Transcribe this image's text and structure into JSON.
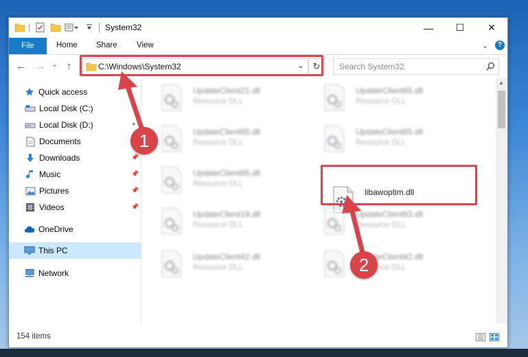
{
  "titlebar": {
    "title": "System32",
    "minimize_glyph": "—",
    "maximize_glyph": "☐",
    "close_glyph": "✕"
  },
  "ribbon": {
    "tabs": [
      "File",
      "Home",
      "Share",
      "View"
    ],
    "expand_glyph": "⌄",
    "help_glyph": "?"
  },
  "navigation": {
    "back_glyph": "←",
    "forward_glyph": "→",
    "dropdown_glyph": "⌄",
    "up_glyph": "↑",
    "address": "C:\\Windows\\System32",
    "refresh_glyph": "↻",
    "search_placeholder": "Search System32",
    "search_glyph": "⚲"
  },
  "sidebar": {
    "quick_access": "Quick access",
    "items": [
      {
        "label": "Local Disk (C:)",
        "icon": "drive-icon"
      },
      {
        "label": "Local Disk (D:)",
        "icon": "drive-icon"
      },
      {
        "label": "Documents",
        "icon": "documents-icon"
      },
      {
        "label": "Downloads",
        "icon": "downloads-icon"
      },
      {
        "label": "Music",
        "icon": "music-icon"
      },
      {
        "label": "Pictures",
        "icon": "pictures-icon"
      },
      {
        "label": "Videos",
        "icon": "videos-icon"
      }
    ],
    "pin_glyph": "📌",
    "onedrive": "OneDrive",
    "this_pc": "This PC",
    "network": "Network"
  },
  "files": [
    {
      "name": "UpdateClient21.dll",
      "type": "Resource DLL"
    },
    {
      "name": "UpdateClient65.dll",
      "type": "Resource DLL"
    },
    {
      "name": "UpdateClient65.dll",
      "type": "Resource DLL"
    },
    {
      "name": "UpdateClient65.dll",
      "type": "Resource DLL"
    },
    {
      "name": "UpdateClient65.dll",
      "type": "Resource DLL"
    },
    {
      "name": "libawoptim.dll",
      "type": ""
    },
    {
      "name": "UpdateClient19.dll",
      "type": "Resource DLL"
    },
    {
      "name": "UpdateClient63.dll",
      "type": "Resource DLL"
    },
    {
      "name": "UpdateClient42.dll",
      "type": "Resource DLL"
    },
    {
      "name": "UpdateClient42.dll",
      "type": "Resource DLL"
    }
  ],
  "status": {
    "item_count": "154 items"
  },
  "annotations": {
    "step1": "1",
    "step2": "2",
    "highlight_color": "#d9444b"
  },
  "colors": {
    "accent": "#1979ca",
    "selection": "#cce8ff"
  }
}
